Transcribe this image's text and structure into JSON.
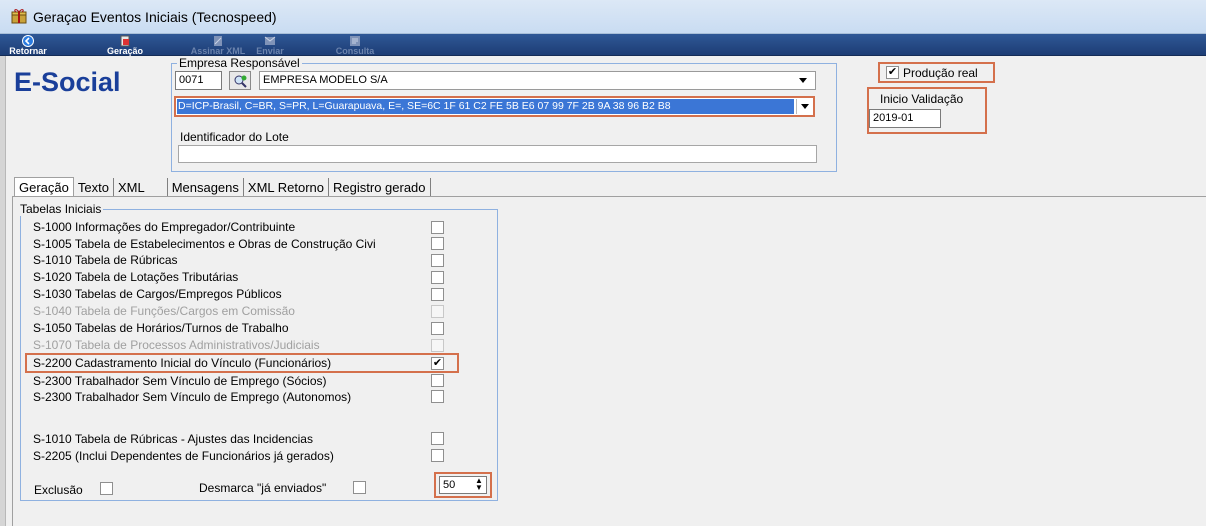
{
  "window": {
    "title": "Geraçao Eventos Iniciais (Tecnospeed)",
    "icon": "gift-icon"
  },
  "toolbar": [
    {
      "label": "Retornar",
      "icon": "back-arrow-icon",
      "enabled": true
    },
    {
      "label": "Geração",
      "icon": "generate-icon",
      "enabled": true
    },
    {
      "label": "Assinar XML",
      "icon": "sign-icon",
      "enabled": false
    },
    {
      "label": "Enviar",
      "icon": "send-icon",
      "enabled": false
    },
    {
      "label": "Consulta",
      "icon": "query-icon",
      "enabled": false
    }
  ],
  "logo": "E-Social",
  "empresa": {
    "legend": "Empresa Responsável",
    "code": "0071",
    "name": "EMPRESA MODELO S/A",
    "certificate": "D=ICP-Brasil, C=BR, S=PR, L=Guarapuava, E=, SE=6C 1F 61 C2 FE 5B E6 07 99 7F 2B 9A 38 96 B2 B8",
    "lote_label": "Identificador do Lote",
    "lote_value": ""
  },
  "producao": {
    "label": "Produção real",
    "checked": true
  },
  "inicio": {
    "label": "Inicio Validação",
    "value": "2019-01"
  },
  "tabs": [
    "Geração",
    "Texto",
    "XML",
    "Mensagens",
    "XML Retorno",
    "Registro gerado"
  ],
  "active_tab": "Geração",
  "tabelas": {
    "legend": "Tabelas Iniciais",
    "items": [
      {
        "label": "S-1000 Informações do Empregador/Contribuinte",
        "checked": false,
        "disabled": false
      },
      {
        "label": "S-1005 Tabela de Estabelecimentos e Obras de Construção Civi",
        "checked": false,
        "disabled": false
      },
      {
        "label": "S-1010 Tabela de Rúbricas",
        "checked": false,
        "disabled": false
      },
      {
        "label": "S-1020 Tabela de Lotações Tributárias",
        "checked": false,
        "disabled": false
      },
      {
        "label": "S-1030 Tabelas de Cargos/Empregos Públicos",
        "checked": false,
        "disabled": false
      },
      {
        "label": "S-1040 Tabela de Funções/Cargos em Comissão",
        "checked": false,
        "disabled": true
      },
      {
        "label": "S-1050 Tabelas de Horários/Turnos de Trabalho",
        "checked": false,
        "disabled": false
      },
      {
        "label": "S-1070 Tabela de Processos Administrativos/Judiciais",
        "checked": false,
        "disabled": true
      },
      {
        "label": "S-2200 Cadastramento Inicial do Vínculo (Funcionários)",
        "checked": true,
        "disabled": false
      },
      {
        "label": "S-2300 Trabalhador Sem Vínculo de Emprego (Sócios)",
        "checked": false,
        "disabled": false
      },
      {
        "label": "S-2300 Trabalhador Sem Vínculo de Emprego (Autonomos)",
        "checked": false,
        "disabled": false
      },
      {
        "label": "S-1010 Tabela de Rúbricas - Ajustes das Incidencias",
        "checked": false,
        "disabled": false
      },
      {
        "label": "S-2205 (Inclui Dependentes de Funcionários já gerados)",
        "checked": false,
        "disabled": false
      }
    ],
    "exclusao_label": "Exclusão",
    "desmarca_label": "Desmarca \"já enviados\"",
    "spin_value": "50"
  }
}
